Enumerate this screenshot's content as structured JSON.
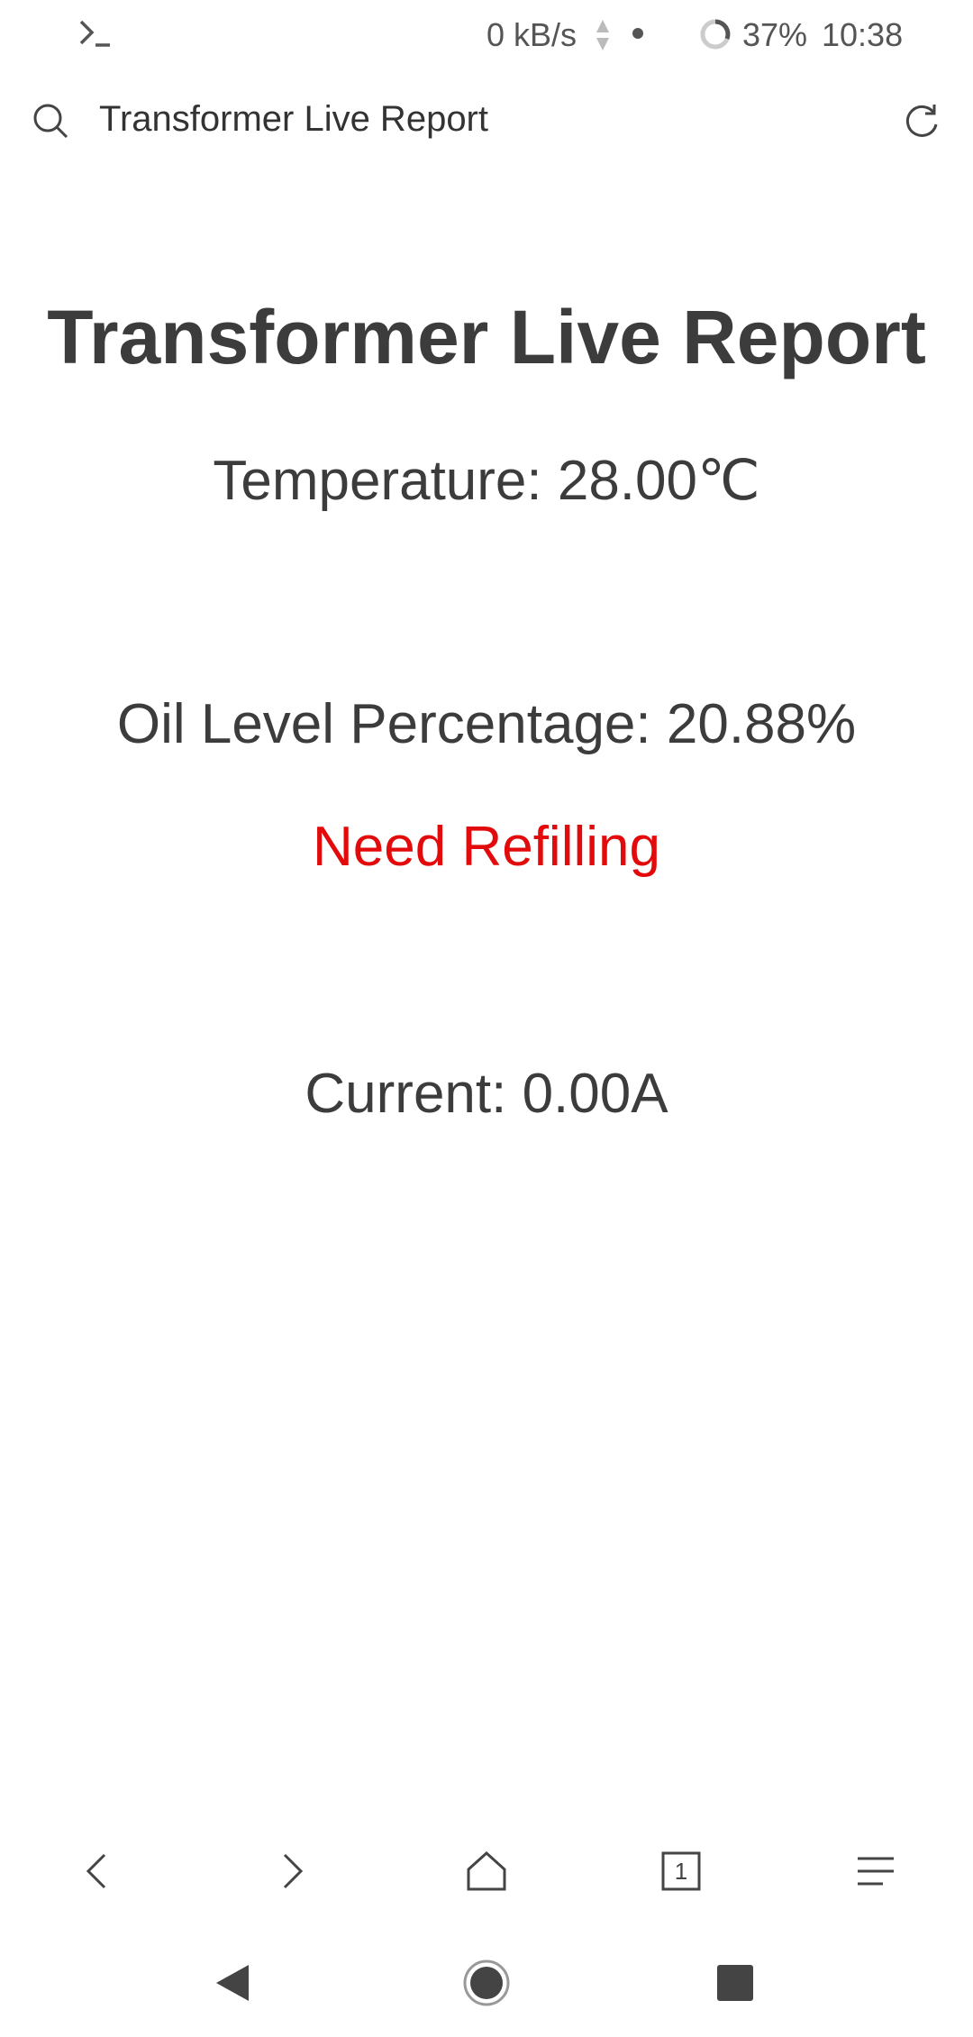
{
  "status_bar": {
    "net_speed": "0 kB/s",
    "battery": "37%",
    "time": "10:38",
    "icons": [
      "terminal-icon",
      "updown-arrows-icon",
      "dot-icon",
      "battery-ring-icon"
    ]
  },
  "address_bar": {
    "title": "Transformer Live Report",
    "icons": [
      "search-icon",
      "refresh-icon"
    ]
  },
  "page": {
    "title": "Transformer Live Report",
    "temperature": "Temperature: 28.00℃",
    "oil_level": "Oil Level Percentage: 20.88%",
    "oil_alert": "Need Refilling",
    "current": "Current: 0.00A"
  },
  "browser_nav": {
    "tab_count": "1",
    "icons": [
      "back-icon",
      "forward-icon",
      "home-icon",
      "tabs-icon",
      "menu-icon"
    ]
  },
  "system_nav": {
    "icons": [
      "back-triangle-icon",
      "home-circle-icon",
      "recents-square-icon"
    ]
  },
  "colors": {
    "text": "#3c3c3c",
    "alert": "#e20a0a",
    "icon": "#555555"
  }
}
